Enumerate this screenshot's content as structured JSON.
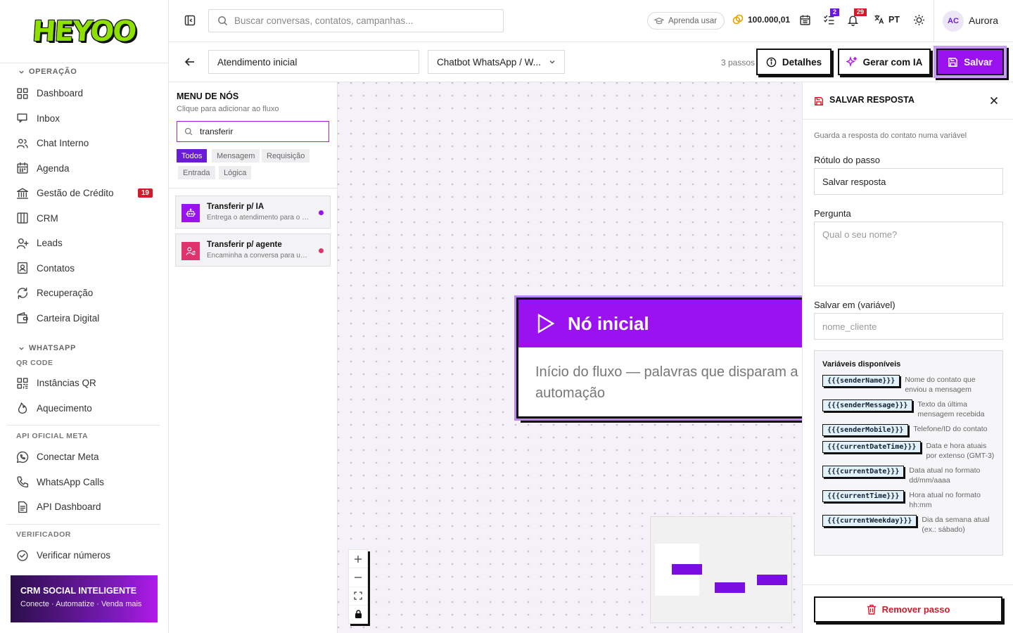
{
  "brand": {
    "logo_text": "HEYOO"
  },
  "sidebar": {
    "sections": [
      {
        "title": "OPERAÇÃO",
        "items": [
          {
            "label": "Dashboard",
            "icon": "dashboard-icon"
          },
          {
            "label": "Inbox",
            "icon": "inbox-icon"
          },
          {
            "label": "Chat Interno",
            "icon": "users-icon"
          },
          {
            "label": "Agenda",
            "icon": "calendar-icon"
          },
          {
            "label": "Gestão de Crédito",
            "icon": "bank-icon",
            "badge": "19"
          },
          {
            "label": "CRM",
            "icon": "columns-icon"
          },
          {
            "label": "Leads",
            "icon": "user-plus-icon"
          },
          {
            "label": "Contatos",
            "icon": "contact-icon"
          },
          {
            "label": "Recuperação",
            "icon": "refresh-icon"
          },
          {
            "label": "Carteira Digital",
            "icon": "wallet-icon"
          }
        ]
      },
      {
        "title": "WHATSAPP",
        "subtitle": "QR CODE",
        "items": [
          {
            "label": "Instâncias QR",
            "icon": "qr-icon"
          },
          {
            "label": "Aquecimento",
            "icon": "flame-icon"
          }
        ]
      },
      {
        "subtitle": "API OFICIAL META",
        "items": [
          {
            "label": "Conectar Meta",
            "icon": "whatsapp-icon"
          },
          {
            "label": "WhatsApp Calls",
            "icon": "phone-icon"
          },
          {
            "label": "API Dashboard",
            "icon": "api-icon"
          }
        ]
      },
      {
        "subtitle": "VERIFICADOR",
        "items": [
          {
            "label": "Verificar números",
            "icon": "check-circle-icon"
          }
        ]
      }
    ],
    "promo": {
      "title": "CRM SOCIAL INTELIGENTE",
      "subtitle": "Conecte · Automatize · Venda mais"
    }
  },
  "topbar": {
    "search_placeholder": "Buscar conversas, contatos, campanhas...",
    "learn_label": "Aprenda usar",
    "credits": "100.000,01",
    "tasks_badge": "2",
    "notifications_badge": "29",
    "language": "PT",
    "user_initials": "AC",
    "user_name": "Aurora"
  },
  "editor": {
    "flow_name": "Atendimento inicial",
    "channel": "Chatbot WhatsApp / W...",
    "steps": "3 passos",
    "details_label": "Detalhes",
    "ai_label": "Gerar com IA",
    "save_label": "Salvar"
  },
  "node_menu": {
    "title": "MENU DE NÓS",
    "subtitle": "Clique para adicionar ao fluxo",
    "search_value": "transferir",
    "filters": [
      "Todos",
      "Mensagem",
      "Requisição",
      "Entrada",
      "Lógica"
    ],
    "active_filter": "Todos",
    "cards": [
      {
        "title": "Transferir p/ IA",
        "desc": "Entrega o atendimento para o as...",
        "color": "#9b12f0",
        "dot": "#9b12f0",
        "icon": "robot-icon"
      },
      {
        "title": "Transferir p/ agente",
        "desc": "Encaminha a conversa para um a...",
        "color": "#e0336d",
        "dot": "#e0336d",
        "icon": "user-switch-icon"
      }
    ]
  },
  "canvas": {
    "start_node": {
      "title": "Nó inicial",
      "body": "Início do fluxo — palavras que disparam a automação"
    },
    "zoom_controls": [
      "+",
      "—",
      "⛶",
      "🔒"
    ]
  },
  "panel": {
    "title": "SALVAR RESPOSTA",
    "description": "Guarda a resposta do contato numa variável",
    "step_label_label": "Rótulo do passo",
    "step_label_value": "Salvar resposta",
    "question_label": "Pergunta",
    "question_placeholder": "Qual o seu nome?",
    "save_in_label": "Salvar em (variável)",
    "save_in_placeholder": "nome_cliente",
    "vars_title": "Variáveis disponíveis",
    "variables": [
      {
        "tag": "{{{senderName}}}",
        "desc": "Nome do contato que enviou a mensagem"
      },
      {
        "tag": "{{{senderMessage}}}",
        "desc": "Texto da última mensagem recebida"
      },
      {
        "tag": "{{{senderMobile}}}",
        "desc": "Telefone/ID do contato"
      },
      {
        "tag": "{{{currentDateTime}}}",
        "desc": "Data e hora atuais por extenso (GMT-3)"
      },
      {
        "tag": "{{{currentDate}}}",
        "desc": "Data atual no formato dd/mm/aaaa"
      },
      {
        "tag": "{{{currentTime}}}",
        "desc": "Hora atual no formato hh:mm"
      },
      {
        "tag": "{{{currentWeekday}}}",
        "desc": "Dia da semana atual (ex.: sábado)"
      }
    ],
    "remove_label": "Remover passo"
  }
}
